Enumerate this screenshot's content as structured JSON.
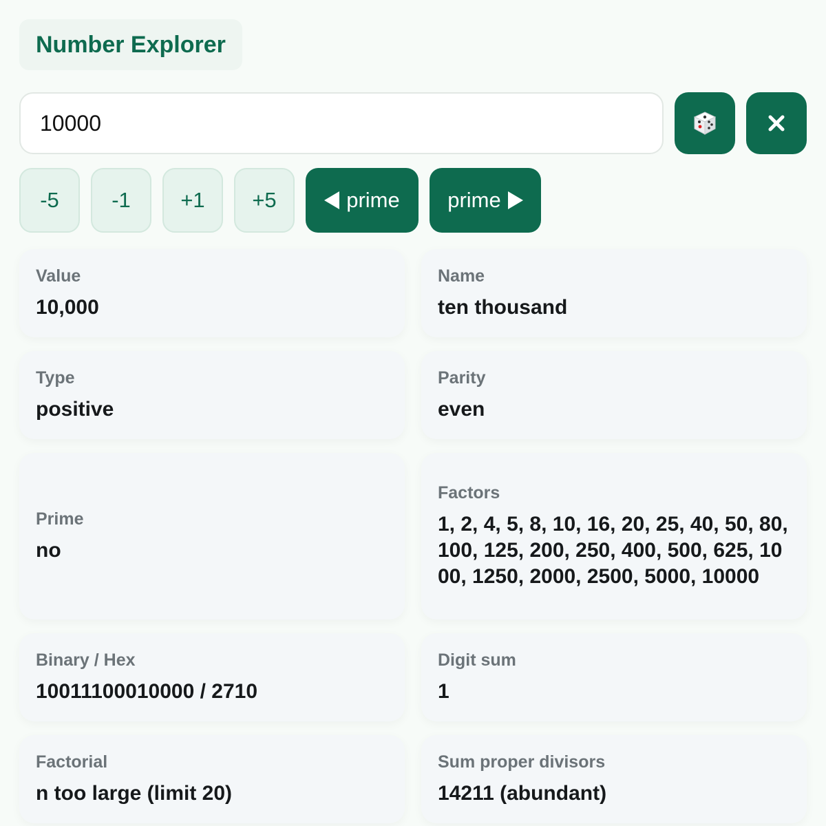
{
  "app": {
    "title": "Number Explorer"
  },
  "input": {
    "value": "10000"
  },
  "icons": {
    "random": "dice-icon",
    "clear": "close-icon"
  },
  "steps": [
    "-5",
    "-1",
    "+1",
    "+5"
  ],
  "prime_nav": {
    "prev_label": "prime",
    "next_label": "prime"
  },
  "cards": {
    "value": {
      "label": "Value",
      "text": "10,000"
    },
    "name": {
      "label": "Name",
      "text": "ten thousand"
    },
    "type": {
      "label": "Type",
      "text": "positive"
    },
    "parity": {
      "label": "Parity",
      "text": "even"
    },
    "prime": {
      "label": "Prime",
      "text": "no"
    },
    "factors": {
      "label": "Factors",
      "text": "1, 2, 4, 5, 8, 10, 16, 20, 25, 40, 50, 80, 100, 125, 200, 250, 400, 500, 625, 1000, 1250, 2000, 2500, 5000, 10000"
    },
    "binary_hex": {
      "label": "Binary / Hex",
      "text": "10011100010000 / 2710"
    },
    "digit_sum": {
      "label": "Digit sum",
      "text": "1"
    },
    "factorial": {
      "label": "Factorial",
      "text": "n too large (limit 20)"
    },
    "sum_proper": {
      "label": "Sum proper divisors",
      "text": "14211 (abundant)"
    }
  },
  "colors": {
    "accent": "#0e6b4f",
    "accent_light": "#e6f3ed",
    "card_bg": "#f4f7f9",
    "page_bg": "#f7fbf8"
  }
}
